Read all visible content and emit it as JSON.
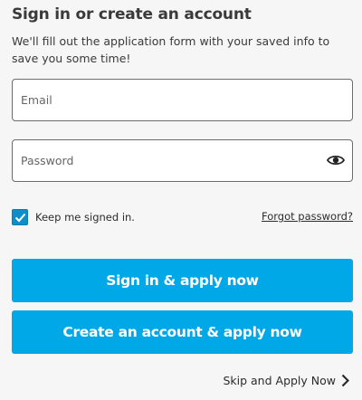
{
  "header": {
    "title": "Sign in or create an account",
    "subtitle": "We'll fill out the application form with your saved info to save you some time!"
  },
  "form": {
    "email": {
      "placeholder": "Email",
      "value": ""
    },
    "password": {
      "placeholder": "Password",
      "value": ""
    },
    "remember_label": "Keep me signed in.",
    "remember_checked": true,
    "forgot_label": "Forgot password?"
  },
  "actions": {
    "signin_label": "Sign in & apply now",
    "create_label": "Create an account & apply now",
    "skip_label": "Skip and Apply Now"
  },
  "icons": {
    "password_toggle": "eye-icon",
    "checkbox_mark": "checkmark-icon",
    "skip_arrow": "chevron-right-icon"
  },
  "colors": {
    "primary_button": "#00a8e8",
    "checkbox": "#0d8ec8",
    "background": "#f6f6f6"
  }
}
